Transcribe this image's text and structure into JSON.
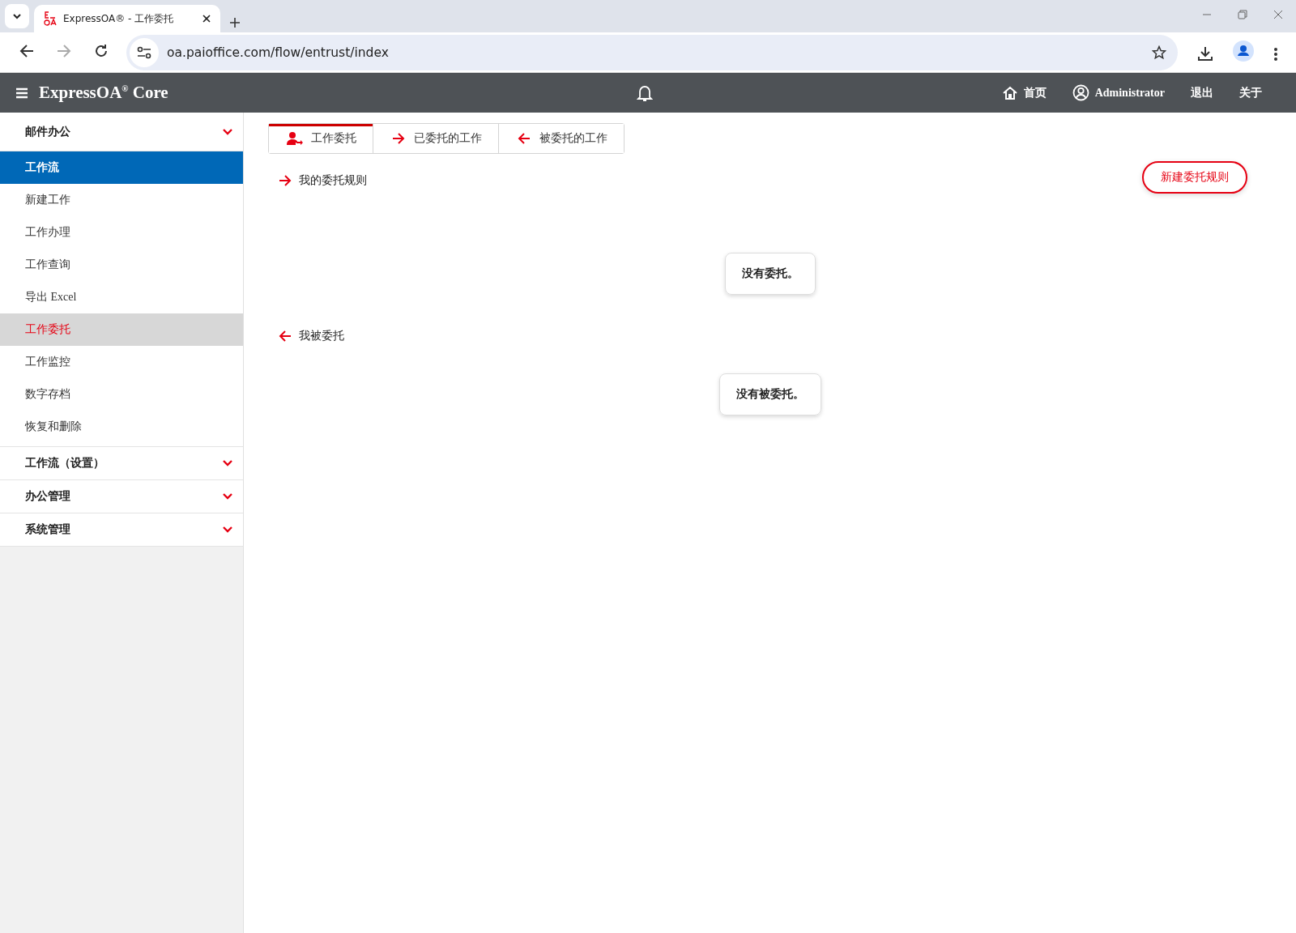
{
  "browser": {
    "tab_title": "ExpressOA® - 工作委托",
    "url": "oa.paioffice.com/flow/entrust/index"
  },
  "header": {
    "brand": "ExpressOA$^{®}$ Core",
    "nav": [
      {
        "label": "首页",
        "kind": "home"
      },
      {
        "label": "Administrator",
        "kind": "user"
      },
      {
        "label": "退出",
        "kind": "text"
      },
      {
        "label": "关于",
        "kind": "text"
      }
    ]
  },
  "sidebar": {
    "groups": [
      {
        "label": "邮件办公",
        "children": [
          {
            "label": "工作流",
            "kind": "section",
            "selected": false
          },
          {
            "label": "新建工作",
            "kind": "link",
            "selected": false
          },
          {
            "label": "工作办理",
            "kind": "link",
            "selected": false
          },
          {
            "label": "工作查询",
            "kind": "link",
            "selected": false
          },
          {
            "label": "导出 Excel",
            "kind": "link",
            "selected": false
          },
          {
            "label": "工作委托",
            "kind": "link",
            "selected": true
          },
          {
            "label": "工作监控",
            "kind": "link",
            "selected": false
          },
          {
            "label": "数字存档",
            "kind": "link",
            "selected": false
          },
          {
            "label": "恢复和删除",
            "kind": "link",
            "selected": false
          }
        ]
      },
      {
        "label": "工作流（设置）"
      },
      {
        "label": "办公管理"
      },
      {
        "label": "系统管理"
      }
    ]
  },
  "tabs": [
    {
      "label": "工作委托",
      "kind": "person",
      "selected": true
    },
    {
      "label": "已委托的工作",
      "kind": "outgoing",
      "selected": false
    },
    {
      "label": "被委托的工作",
      "kind": "incoming",
      "selected": false
    }
  ],
  "new_rule_button": "新建委托规则",
  "sections": [
    {
      "title": "我的委托规则",
      "kind": "outgoing",
      "empty_text": "没有委托。"
    },
    {
      "title": "我被委托",
      "kind": "incoming",
      "empty_text": "没有被委托。"
    }
  ]
}
